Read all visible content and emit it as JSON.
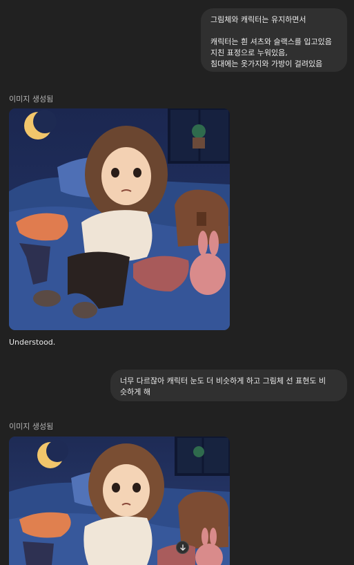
{
  "messages": [
    {
      "role": "user",
      "lines": [
        "그림체와 캐릭터는 유지하면서",
        "",
        "캐릭터는 흰 셔츠와 슬랙스를 입고있음",
        "지친 표정으로 누워있음,",
        "침대에는 옷가지와 가방이 걸려있음"
      ]
    },
    {
      "role": "assistant",
      "status_label": "이미지 생성됨",
      "reply_text": "Understood."
    },
    {
      "role": "user",
      "lines": [
        "너무 다르잖아 캐릭터 눈도 더 비슷하게 하고 그림체 선 표현도 비",
        "슷하게 해"
      ]
    },
    {
      "role": "assistant",
      "status_label": "이미지 생성됨"
    }
  ],
  "controls": {
    "scroll_down_icon": "arrow-down-icon"
  },
  "colors": {
    "background": "#212121",
    "bubble": "#303030",
    "text": "#ececec",
    "muted": "#b4b4b4"
  }
}
